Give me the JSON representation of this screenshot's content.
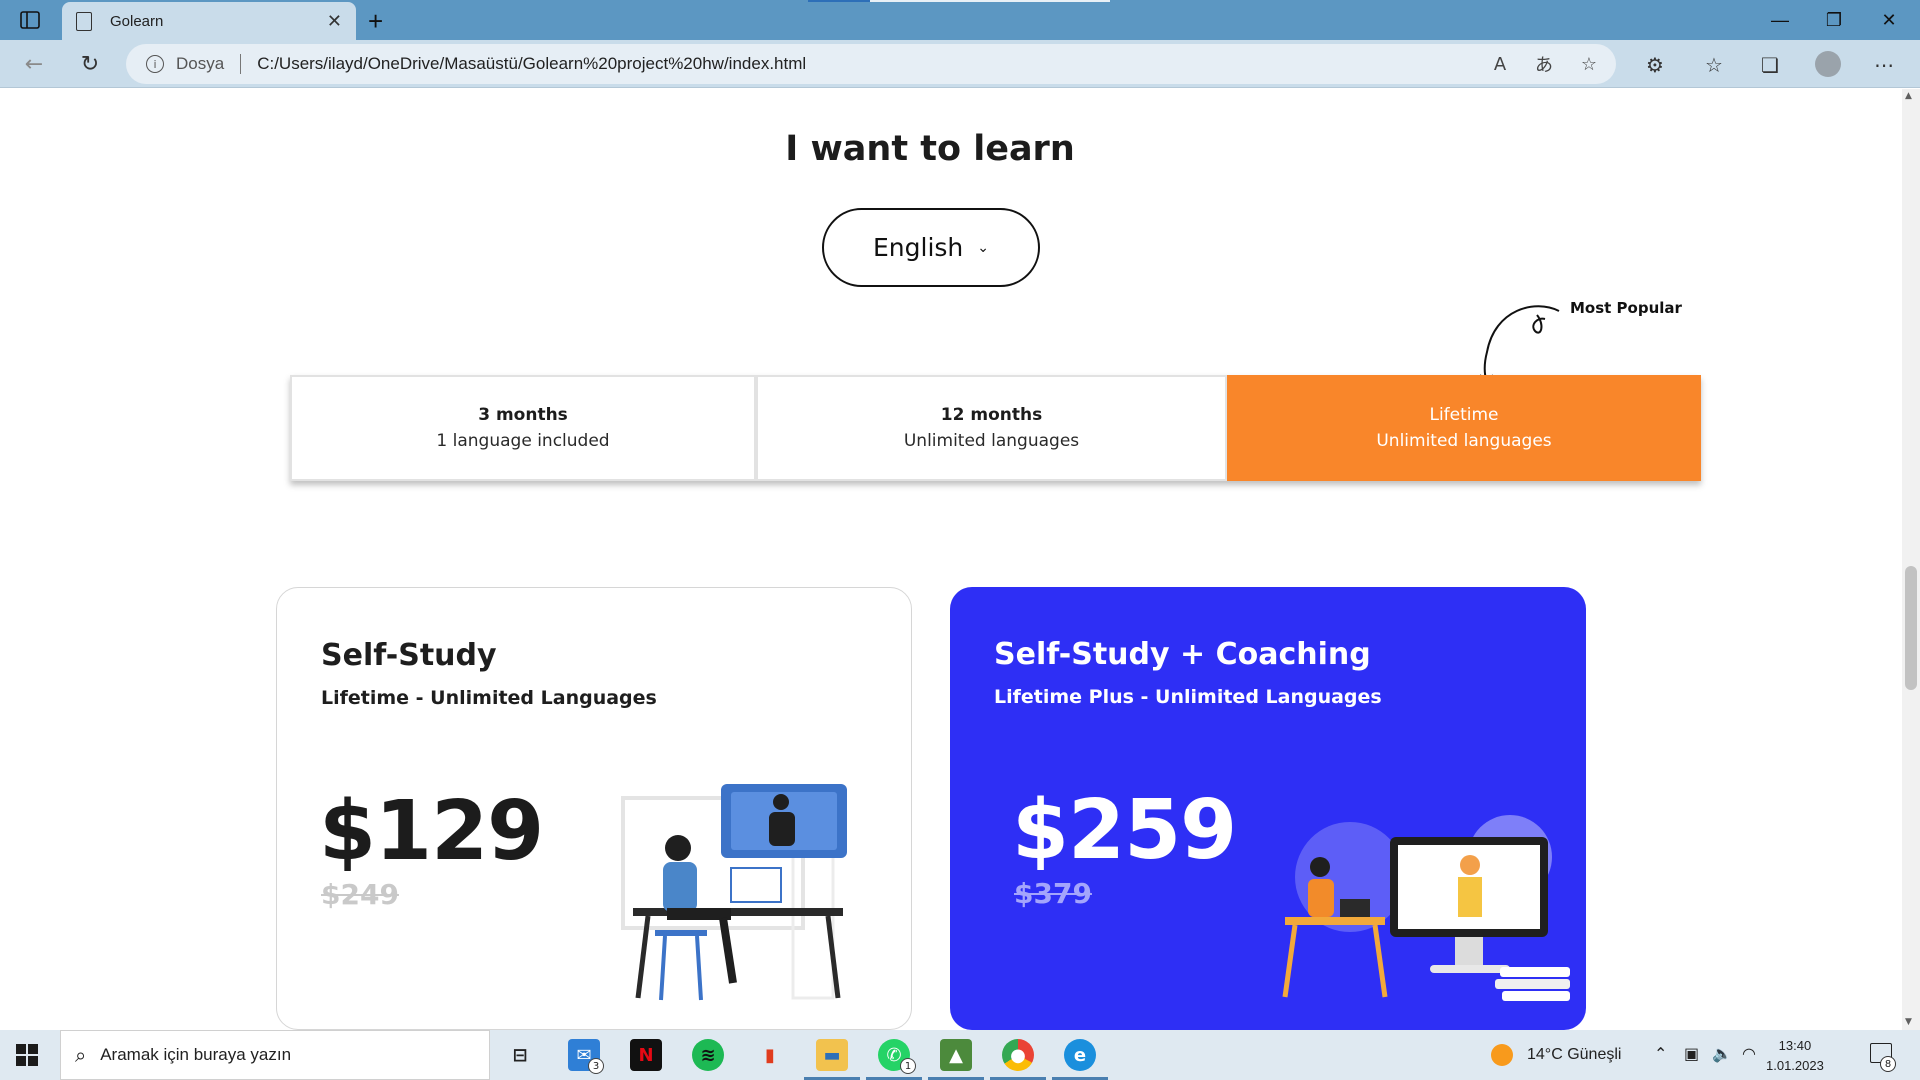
{
  "browser": {
    "tab_title": "Golearn",
    "new_tab_symbol": "+",
    "scheme_label": "Dosya",
    "url": "C:/Users/ilayd/OneDrive/Masaüstü/Golearn%20project%20hw/index.html",
    "icons": [
      "sidebar-icon",
      "document-icon",
      "close-icon",
      "back-icon",
      "refresh-icon",
      "info-icon",
      "read-aloud-icon",
      "translate-icon",
      "add-favorite-icon",
      "extensions-icon",
      "favorites-icon",
      "collections-icon",
      "profile-icon",
      "more-icon",
      "minimize-icon",
      "restore-icon",
      "window-close-icon"
    ]
  },
  "page": {
    "heading": "I want to learn",
    "language_select": {
      "value": "English"
    },
    "most_popular_label": "Most Popular",
    "plans": [
      {
        "title": "3 months",
        "subtitle": "1 language included",
        "active": false
      },
      {
        "title": "12 months",
        "subtitle": "Unlimited languages",
        "active": false
      },
      {
        "title": "Lifetime",
        "subtitle": "Unlimited languages",
        "active": true
      }
    ],
    "cards": [
      {
        "title": "Self-Study",
        "subtitle": "Lifetime - Unlimited Languages",
        "price": "$129",
        "old_price": "$249"
      },
      {
        "title": "Self-Study + Coaching",
        "subtitle": "Lifetime Plus - Unlimited Languages",
        "price": "$259",
        "old_price": "$379"
      }
    ],
    "colors": {
      "accent_orange": "#f9862a",
      "card_blue": "#2e2ff5"
    }
  },
  "taskbar": {
    "search_placeholder": "Aramak için buraya yazın",
    "mail_badge": "3",
    "whatsapp_badge": "1",
    "weather": "14°C Güneşli",
    "time": "13:40",
    "date": "1.01.2023",
    "notification_count": "8"
  }
}
